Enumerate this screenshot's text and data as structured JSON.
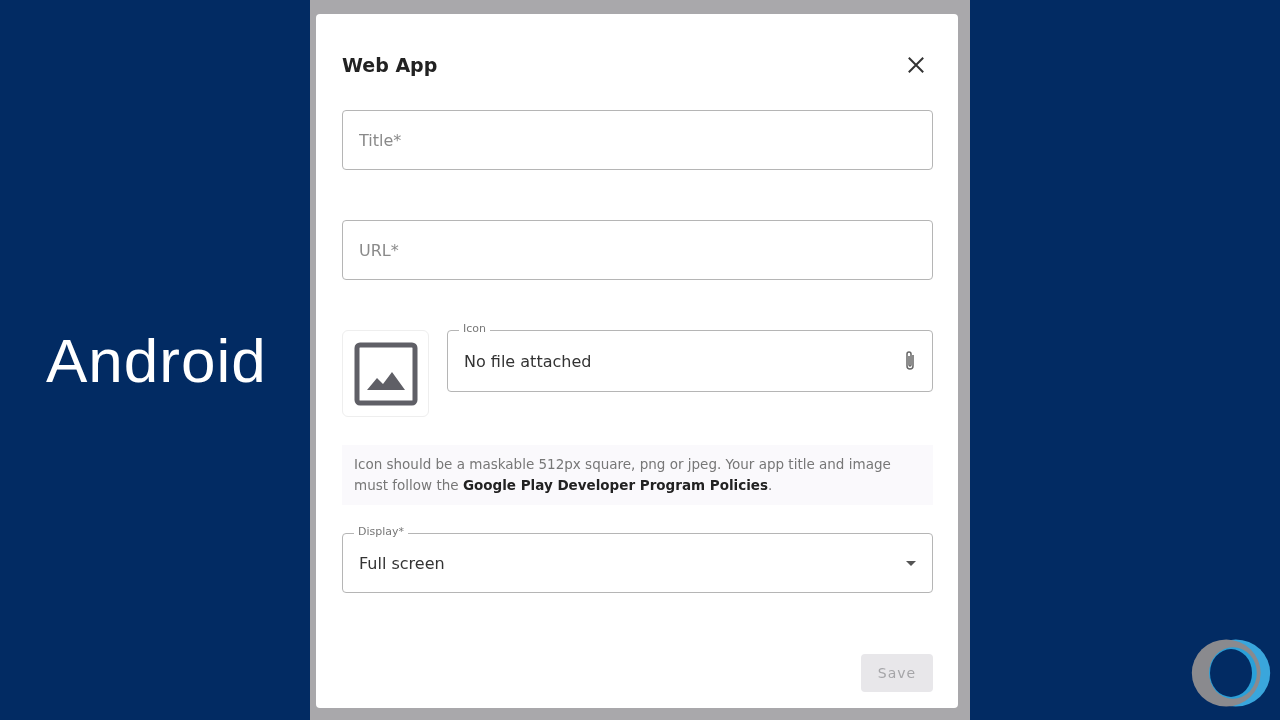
{
  "overlay_text": "Android",
  "dialog": {
    "title": "Web App",
    "fields": [
      {
        "placeholder": "Title*"
      },
      {
        "placeholder": "URL*"
      }
    ],
    "icon_field": {
      "label": "Icon",
      "value": "No file attached"
    },
    "hint": "Icon should be a maskable 512px square, png or jpeg. Your app title and image must follow the **Google Play Developer Program Policies**.",
    "display": {
      "label": "Display*",
      "value": "Full screen"
    },
    "save": {
      "label": "Save",
      "disabled": true
    }
  }
}
